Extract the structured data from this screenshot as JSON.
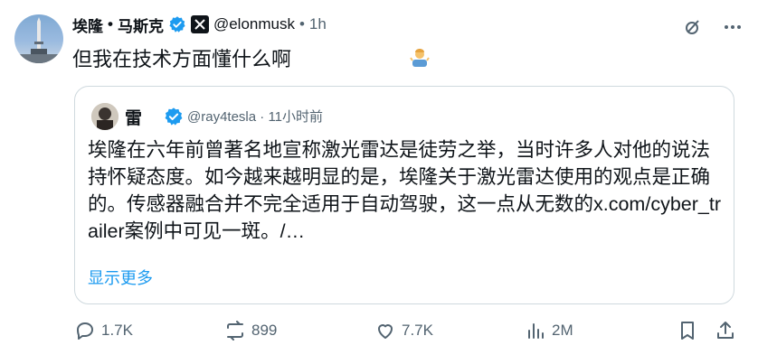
{
  "author": {
    "name": "埃隆",
    "name_sep": "•",
    "name2": "马斯克",
    "handle": "@elonmusk",
    "dot": "•",
    "time": "1h",
    "verified_color": "#1d9bf0"
  },
  "tweet": {
    "text": "但我在技术方面懂什么啊",
    "emoji": "person-shrugging-icon"
  },
  "quote": {
    "name": "雷",
    "handle": "@ray4tesla",
    "dot": "·",
    "time": "11小时前",
    "text": "埃隆在六年前曾著名地宣称激光雷达是徒劳之举，当时许多人对他的说法持怀疑态度。如今越来越明显的是，埃隆关于激光雷达使用的观点是正确的。传感器融合并不完全适用于自动驾驶，这一点从无数的x.com/cyber_trailer案例中可见一斑。/…",
    "show_more": "显示更多"
  },
  "actions": {
    "replies": "1.7K",
    "reposts": "899",
    "likes": "7.7K",
    "views": "2M"
  },
  "icons": {
    "top": [
      "grok-icon",
      "more-icon"
    ],
    "bottom": [
      "reply-icon",
      "repost-icon",
      "like-icon",
      "views-icon",
      "bookmark-icon",
      "share-icon"
    ]
  }
}
